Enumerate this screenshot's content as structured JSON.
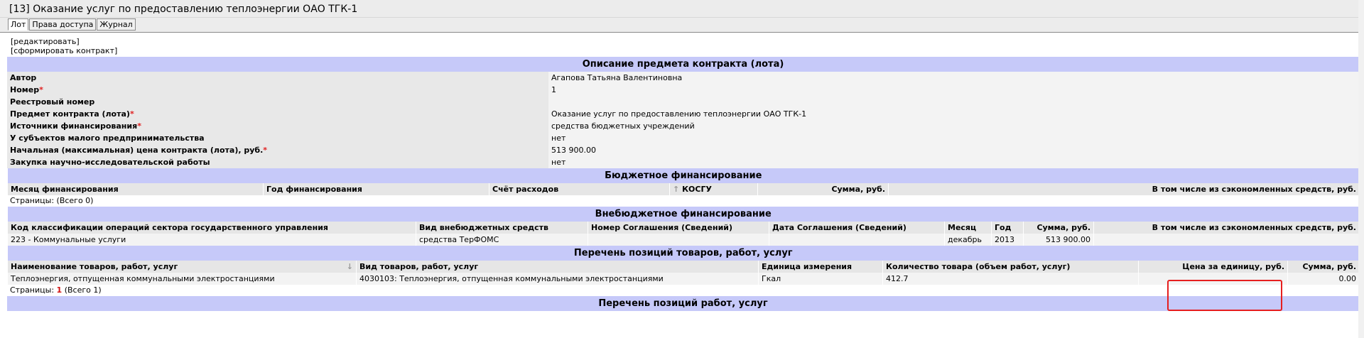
{
  "page": {
    "title": "[13] Оказание услуг по предоставлению теплоэнергии ОАО ТГК-1",
    "tabs": [
      "Лот",
      "Права доступа",
      "Журнал"
    ],
    "links": [
      "[редактировать]",
      "[сформировать контракт]"
    ]
  },
  "contract": {
    "section_title": "Описание предмета контракта (лота)",
    "fields": [
      {
        "label": "Автор",
        "required": false,
        "value": "Агапова Татьяна Валентиновна"
      },
      {
        "label": "Номер",
        "required": true,
        "value": "1"
      },
      {
        "label": "Реестровый номер",
        "required": false,
        "value": ""
      },
      {
        "label": "Предмет контракта (лота)",
        "required": true,
        "value": "Оказание услуг по предоставлению теплоэнергии ОАО ТГК-1"
      },
      {
        "label": "Источники финансирования",
        "required": true,
        "value": "средства бюджетных учреждений"
      },
      {
        "label": "У субъектов малого предпринимательства",
        "required": false,
        "value": "нет"
      },
      {
        "label": "Начальная (максимальная) цена контракта (лота), руб.",
        "required": true,
        "value": "513 900.00"
      },
      {
        "label": "Закупка научно-исследовательской работы",
        "required": false,
        "value": "нет"
      }
    ]
  },
  "budget": {
    "section_title": "Бюджетное финансирование",
    "columns": [
      "Месяц финансирования",
      "Год финансирования",
      "Счёт расходов",
      "КОСГУ",
      "Сумма, руб.",
      "В том числе из сэкономленных средств, руб."
    ],
    "pager": "Страницы:  (Всего 0)"
  },
  "offbudget": {
    "section_title": "Внебюджетное финансирование",
    "columns": [
      "Код классификации операций сектора государственного управления",
      "Вид внебюджетных средств",
      "Номер Соглашения (Сведений)",
      "Дата Соглашения (Сведений)",
      "Месяц",
      "Год",
      "Сумма, руб.",
      "В том числе из сэкономленных средств, руб."
    ],
    "row": [
      "223 - Коммунальные услуги",
      "средства ТерФОМС",
      "",
      "",
      "декабрь",
      "2013",
      "513 900.00",
      ""
    ]
  },
  "goods": {
    "section_title": "Перечень позиций товаров, работ, услуг",
    "columns": [
      "Наименование товаров, работ, услуг",
      "Вид товаров, работ, услуг",
      "Единица измерения",
      "Количество товара (объем работ, услуг)",
      "Цена за единицу, руб.",
      "Сумма, руб."
    ],
    "row": [
      "Теплоэнергия, отпущенная коммунальными электростанциями",
      "4030103: Теплоэнергия, отпущенная коммунальными электростанциями",
      "Гкал",
      "412.7",
      "",
      "0.00"
    ],
    "pager_label": "Страницы:",
    "pager_current": "1",
    "pager_total": "(Всего 1)"
  },
  "works": {
    "section_title": "Перечень позиций работ, услуг"
  },
  "icons": {
    "sort_up": "sort-up-arrow-icon",
    "sort_down": "sort-down-arrow-icon"
  },
  "colors": {
    "section_header": "#c6c9f9",
    "label_bg": "#e8e8e8",
    "required": "#e02020",
    "highlight": "#e61e1e"
  }
}
